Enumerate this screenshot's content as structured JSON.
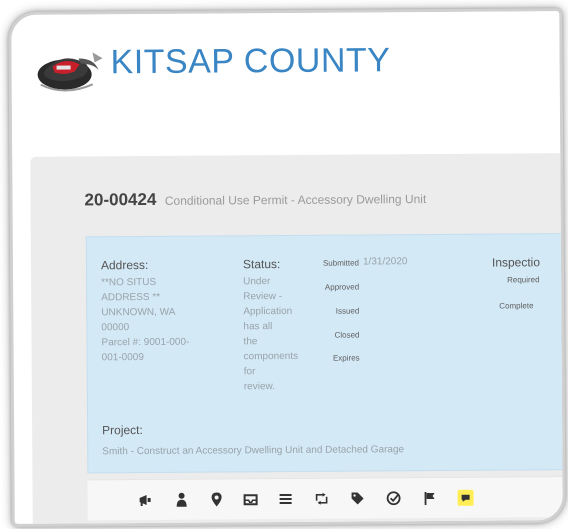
{
  "header": {
    "brand": "KITSAP COUNTY"
  },
  "permit": {
    "number": "20-00424",
    "description": "Conditional Use Permit - Accessory Dwelling Unit"
  },
  "details": {
    "address_label": "Address:",
    "address_lines": [
      "**NO SITUS",
      "ADDRESS **",
      "UNKNOWN, WA",
      "00000",
      "Parcel #: 9001-000-",
      "001-0009"
    ],
    "status_label": "Status:",
    "status_lines": [
      "Under",
      "Review -",
      "Application",
      "has all",
      "the",
      "components",
      "for",
      "review."
    ],
    "dates": {
      "submitted_label": "Submitted",
      "submitted_value": "1/31/2020",
      "approved_label": "Approved",
      "issued_label": "Issued",
      "closed_label": "Closed",
      "expires_label": "Expires"
    },
    "inspections": {
      "label": "Inspectio",
      "required_label": "Required",
      "completed_label": "Complete"
    },
    "project_label": "Project:",
    "project_value": "Smith - Construct an Accessory Dwelling Unit and Detached Garage"
  },
  "toolbar": {
    "icons": [
      "megaphone-icon",
      "person-icon",
      "map-pin-icon",
      "inbox-icon",
      "list-icon",
      "retweet-icon",
      "tag-icon",
      "checkmark-icon",
      "flag-icon",
      "comment-icon"
    ],
    "accent": "#ffee55"
  },
  "colors": {
    "brand": "#3a86c4",
    "info_bg": "#d3e9f6",
    "panel_bg": "#ececec"
  }
}
